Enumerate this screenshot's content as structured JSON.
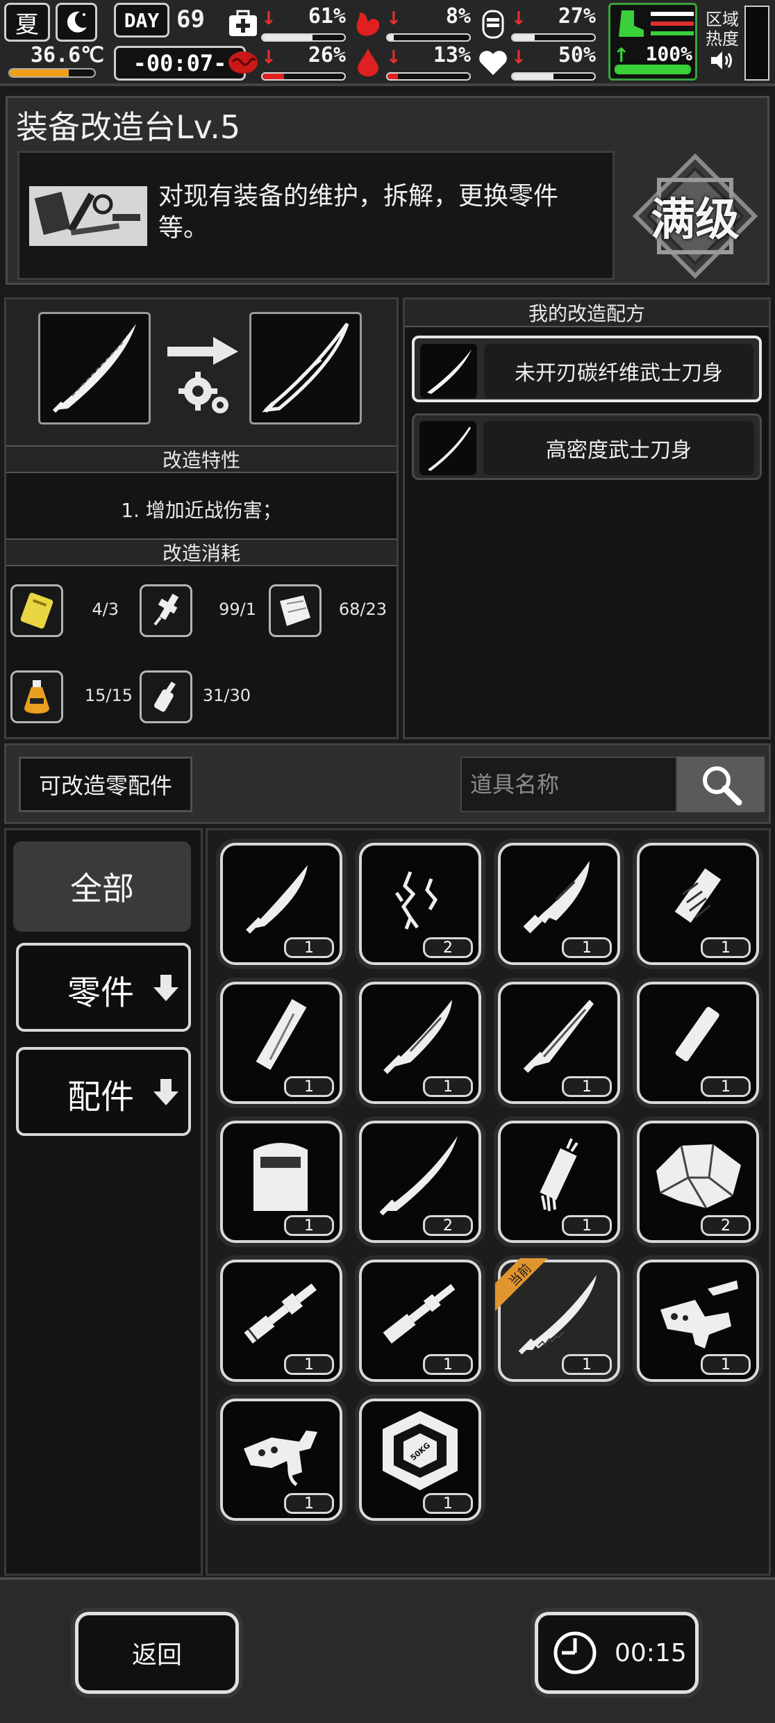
{
  "status": {
    "season": "夏",
    "temperature": "36.6℃",
    "day_label": "DAY",
    "day_number": "69",
    "time": "-00:07-",
    "zone_heat_label_1": "区域",
    "zone_heat_label_2": "热度",
    "stats": [
      {
        "name": "health",
        "icon": "medkit-icon",
        "pct": "61%",
        "value": 0.61
      },
      {
        "name": "hunger",
        "icon": "stomach-icon",
        "pct": "8%",
        "value": 0.08
      },
      {
        "name": "energy",
        "icon": "battery-icon",
        "pct": "27%",
        "value": 0.27
      },
      {
        "name": "infection",
        "icon": "brain-icon",
        "pct": "26%",
        "value": 0.26
      },
      {
        "name": "thirst",
        "icon": "water-drop-icon",
        "pct": "13%",
        "value": 0.13
      },
      {
        "name": "mood",
        "icon": "heart-icon",
        "pct": "50%",
        "value": 0.5
      }
    ],
    "stamina_pct": "100%",
    "stamina_value": 1.0
  },
  "header": {
    "title": "装备改造台Lv.5",
    "description": "对现有装备的维护，拆解，更换零件等。",
    "max_level_label": "满级"
  },
  "modify": {
    "traits_heading": "改造特性",
    "trait_text": "1. 增加近战伤害；",
    "cost_heading": "改造消耗",
    "costs": [
      {
        "icon": "gold-plate-icon",
        "value": "4/3"
      },
      {
        "icon": "tool-kit-icon",
        "value": "99/1"
      },
      {
        "icon": "cloth-icon",
        "value": "68/23"
      },
      {
        "icon": "oil-bottle-icon",
        "value": "15/15"
      },
      {
        "icon": "glue-bottle-icon",
        "value": "31/30"
      }
    ]
  },
  "recipes": {
    "heading": "我的改造配方",
    "items": [
      {
        "label": "未开刃碳纤维武士刀身",
        "selected": true
      },
      {
        "label": "高密度武士刀身",
        "selected": false
      }
    ]
  },
  "search": {
    "category_label": "可改造零配件",
    "placeholder": "道具名称"
  },
  "categories": {
    "all_label": "全部",
    "parts_label": "零件",
    "accessories_label": "配件"
  },
  "items": [
    {
      "icon": "short-blade-icon",
      "qty": "1"
    },
    {
      "icon": "wire-fragments-icon",
      "qty": "2"
    },
    {
      "icon": "serrated-blade-icon",
      "qty": "1"
    },
    {
      "icon": "wrapped-handle-icon",
      "qty": "1"
    },
    {
      "icon": "metal-bar-icon",
      "qty": "1"
    },
    {
      "icon": "machete-blade-icon",
      "qty": "1"
    },
    {
      "icon": "long-blade-icon",
      "qty": "1"
    },
    {
      "icon": "short-bar-icon",
      "qty": "1"
    },
    {
      "icon": "chair-frame-icon",
      "qty": "1"
    },
    {
      "icon": "katana-blade-icon",
      "qty": "2"
    },
    {
      "icon": "grip-wrap-icon",
      "qty": "1"
    },
    {
      "icon": "armor-plate-icon",
      "qty": "2"
    },
    {
      "icon": "suppressor-icon",
      "qty": "1"
    },
    {
      "icon": "barrel-icon",
      "qty": "1"
    },
    {
      "icon": "serrated-katana-icon",
      "qty": "1",
      "current": true,
      "current_label": "当前"
    },
    {
      "icon": "gun-receiver-icon",
      "qty": "1"
    },
    {
      "icon": "trigger-group-icon",
      "qty": "1"
    },
    {
      "icon": "weight-plate-icon",
      "qty": "1",
      "weight_label": "50KG"
    }
  ],
  "bottom": {
    "back_label": "返回",
    "timer_label": "00:15"
  }
}
